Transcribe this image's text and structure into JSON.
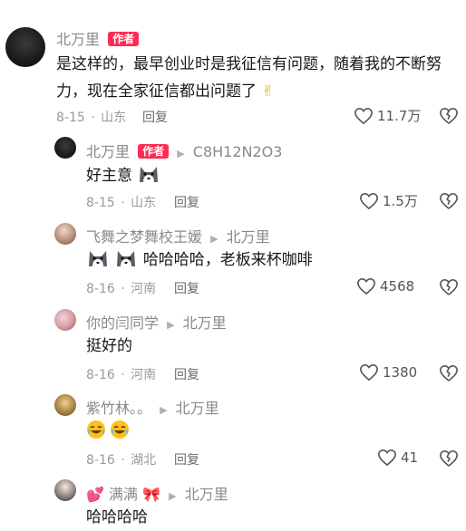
{
  "comments": [
    {
      "author": "北万里",
      "badge": "作者",
      "text": "是这样的，最早创业时是我征信有问题，随着我的不断努力，现在全家征信都出问题了",
      "emoji": "✌",
      "date": "8-15",
      "location": "山东",
      "reply_label": "回复",
      "likes": "11.7万"
    }
  ],
  "replies": [
    {
      "author": "北万里",
      "badge": "作者",
      "reply_to": "C8H12N2O3",
      "text": "好主意",
      "date": "8-15",
      "location": "山东",
      "reply_label": "回复",
      "likes": "1.5万"
    },
    {
      "author": "飞舞之梦舞校王媛",
      "reply_to": "北万里",
      "text": "哈哈哈哈，老板来杯咖啡",
      "date": "8-16",
      "location": "河南",
      "reply_label": "回复",
      "likes": "4568"
    },
    {
      "author": "你的闫同学",
      "reply_to": "北万里",
      "text": "挺好的",
      "date": "8-16",
      "location": "河南",
      "reply_label": "回复",
      "likes": "1380"
    },
    {
      "author": "紫竹林。。",
      "reply_to": "北万里",
      "text": "",
      "date": "8-16",
      "location": "湖北",
      "reply_label": "回复",
      "likes": "41"
    },
    {
      "author": "满满",
      "reply_to": "北万里",
      "text": "哈哈哈哈"
    }
  ],
  "colors": {
    "badge": "#fe2c55",
    "meta": "#9a9a9a"
  }
}
